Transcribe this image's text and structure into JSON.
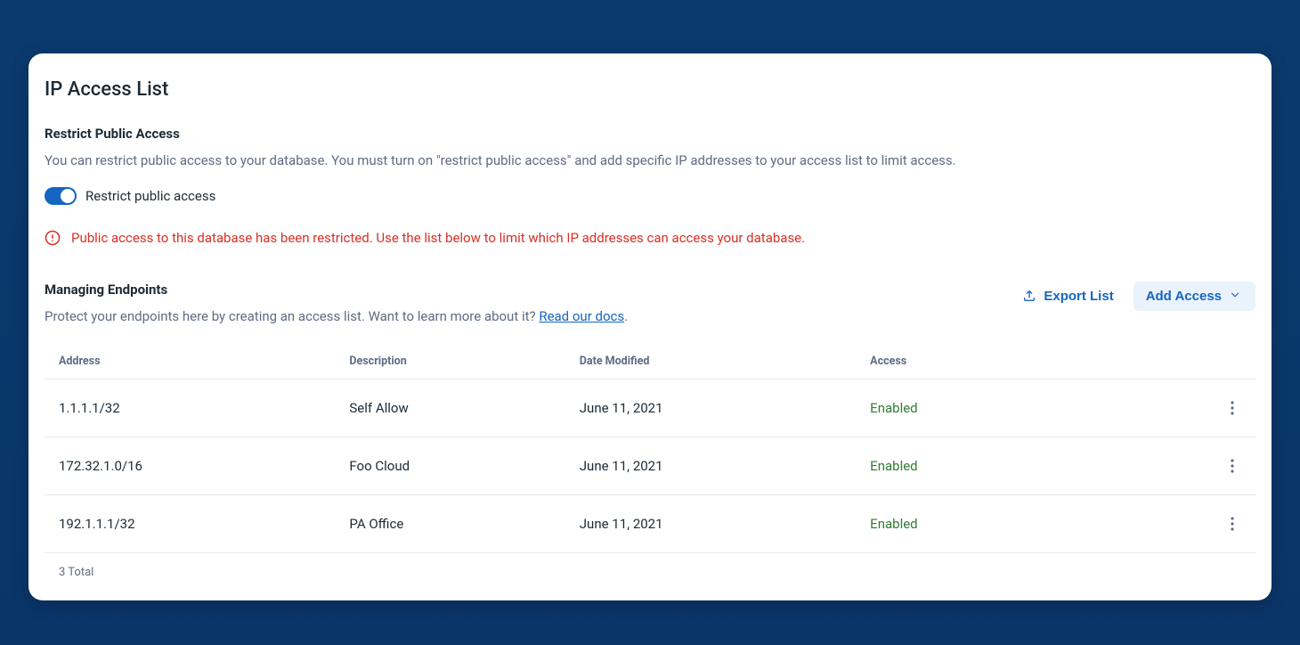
{
  "page": {
    "title": "IP Access List"
  },
  "restrict": {
    "heading": "Restrict Public Access",
    "description": "You can restrict public access to your database. You must turn on \"restrict public access\" and add specific IP addresses to your access list to limit access.",
    "toggle_label": "Restrict public access",
    "toggle_on": true
  },
  "alert": {
    "text": "Public access to this database has been restricted. Use the list below to limit which IP addresses can access your database."
  },
  "endpoints": {
    "heading": "Managing Endpoints",
    "description_prefix": "Protect your endpoints here by creating an access list. Want to learn more about it? ",
    "docs_link_label": "Read our docs",
    "description_suffix": ".",
    "export_label": "Export List",
    "add_label": "Add Access"
  },
  "table": {
    "headers": {
      "address": "Address",
      "description": "Description",
      "date_modified": "Date Modified",
      "access": "Access"
    },
    "rows": [
      {
        "address": "1.1.1.1/32",
        "description": "Self Allow",
        "date_modified": "June 11, 2021",
        "access": "Enabled"
      },
      {
        "address": "172.32.1.0/16",
        "description": "Foo Cloud",
        "date_modified": "June 11, 2021",
        "access": "Enabled"
      },
      {
        "address": "192.1.1.1/32",
        "description": "PA Office",
        "date_modified": "June 11, 2021",
        "access": "Enabled"
      }
    ],
    "footer": "3 Total"
  }
}
